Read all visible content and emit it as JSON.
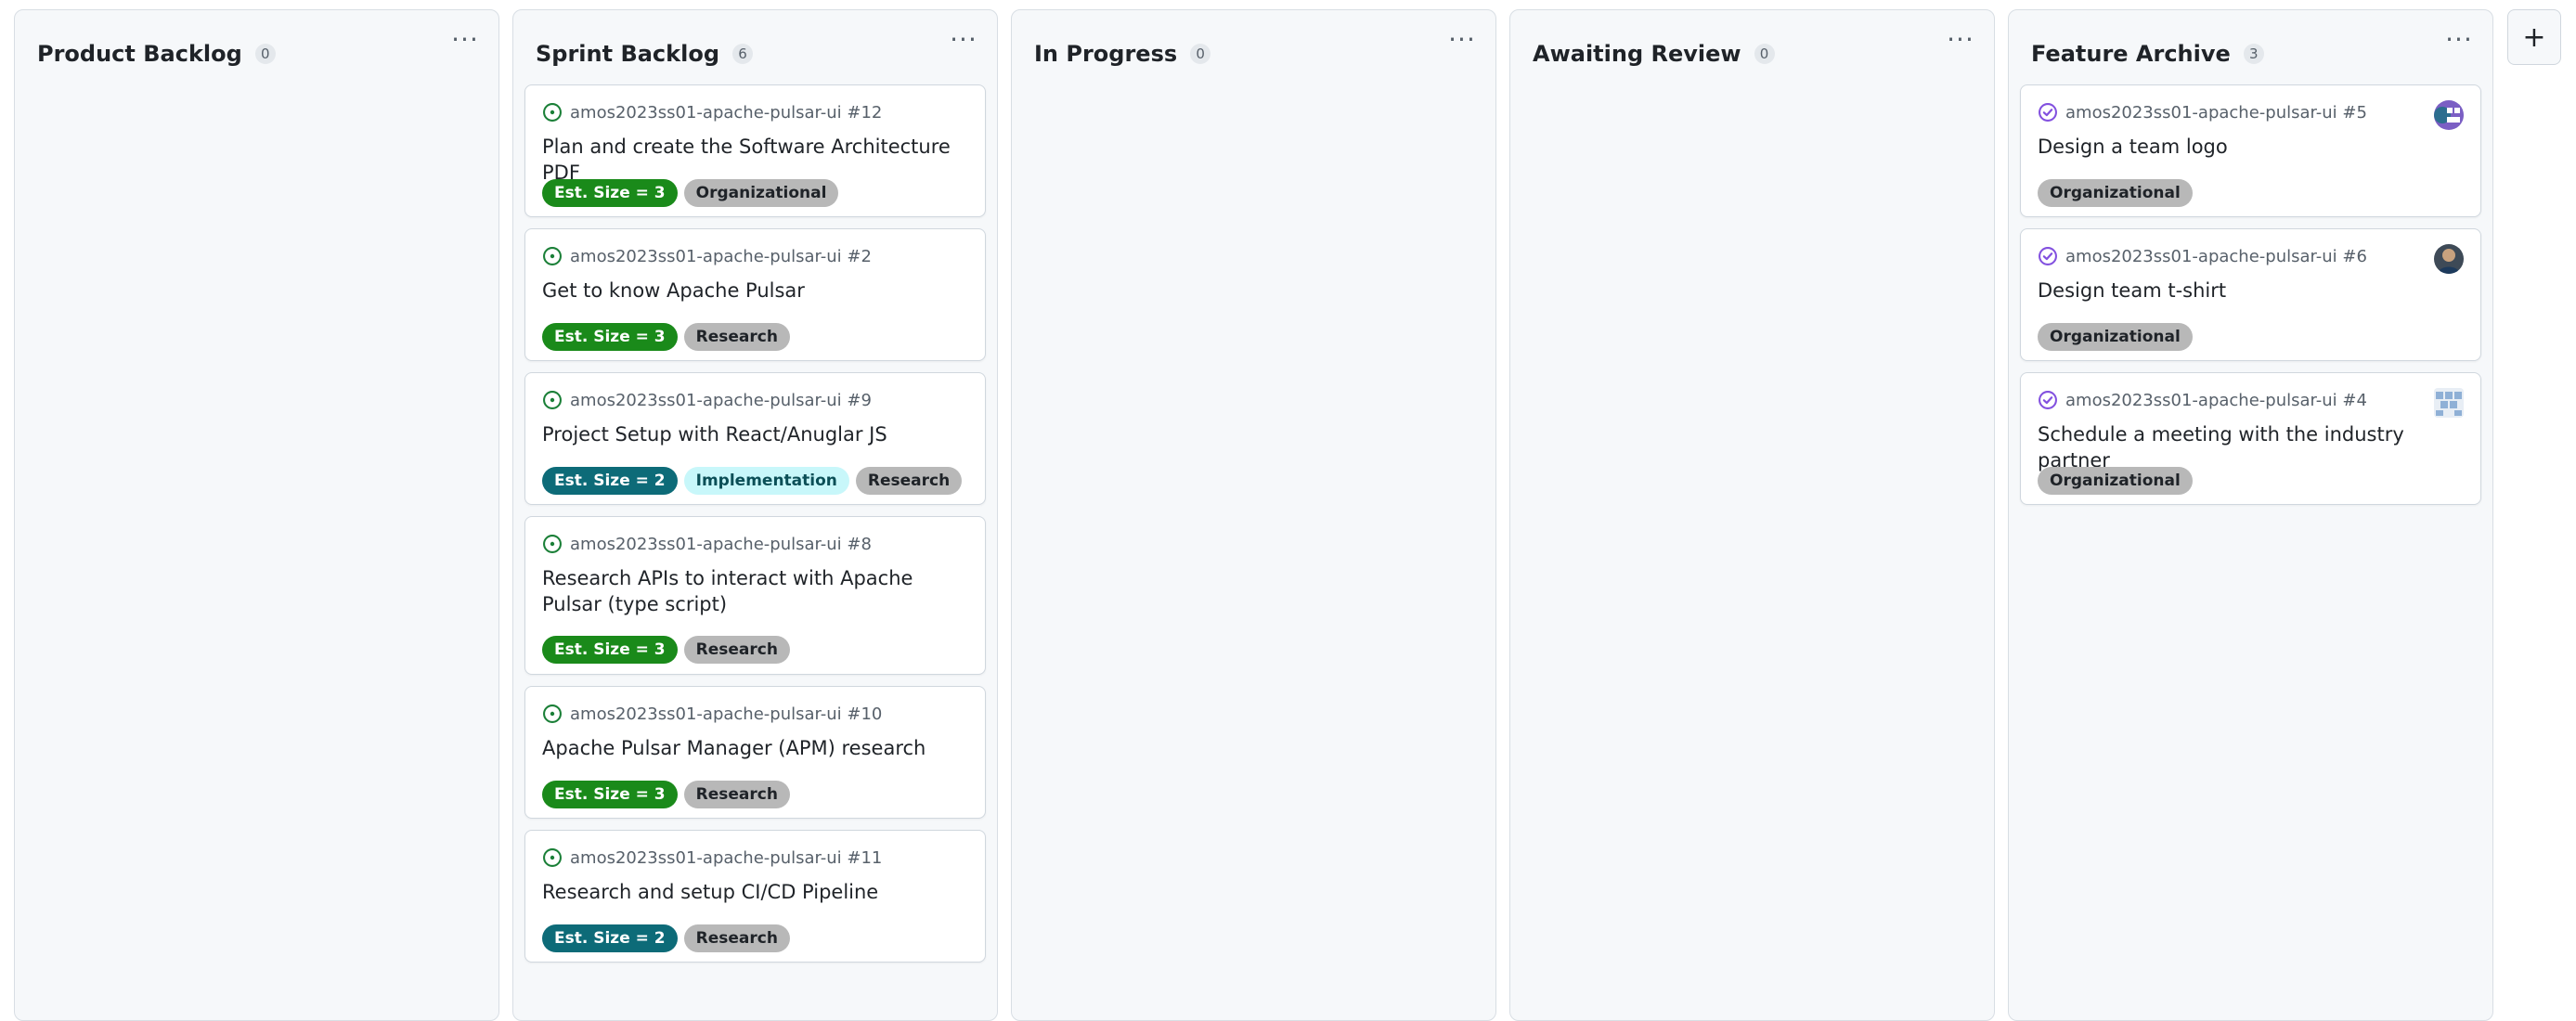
{
  "colors": {
    "open_issue_green": "#1a7f37",
    "closed_issue_purple": "#8250df",
    "size3_bg": "#1a8a1a",
    "size2_bg": "#0d6b78",
    "organizational_bg": "#b8b8b8",
    "research_bg": "#b8b8b8",
    "implementation_bg": "#c8f7fa"
  },
  "add_column": {
    "label": "+"
  },
  "columns": [
    {
      "title": "Product Backlog",
      "count": "0",
      "menu": "···",
      "cards": []
    },
    {
      "title": "Sprint Backlog",
      "count": "6",
      "menu": "···",
      "cards": [
        {
          "ref": "amos2023ss01-apache-pulsar-ui #12",
          "title": "Plan and create the Software Architecture PDF",
          "status": "open",
          "labels": [
            "Est. Size = 3",
            "Organizational"
          ]
        },
        {
          "ref": "amos2023ss01-apache-pulsar-ui #2",
          "title": "Get to know Apache Pulsar",
          "status": "open",
          "labels": [
            "Est. Size = 3",
            "Research"
          ]
        },
        {
          "ref": "amos2023ss01-apache-pulsar-ui #9",
          "title": "Project Setup with React/Anuglar JS",
          "status": "open",
          "labels": [
            "Est. Size = 2",
            "Implementation",
            "Research"
          ]
        },
        {
          "ref": "amos2023ss01-apache-pulsar-ui #8",
          "title": "Research APIs to interact with Apache Pulsar (type script)",
          "status": "open",
          "labels": [
            "Est. Size = 3",
            "Research"
          ]
        },
        {
          "ref": "amos2023ss01-apache-pulsar-ui #10",
          "title": "Apache Pulsar Manager (APM) research",
          "status": "open",
          "labels": [
            "Est. Size = 3",
            "Research"
          ]
        },
        {
          "ref": "amos2023ss01-apache-pulsar-ui #11",
          "title": "Research and setup CI/CD Pipeline",
          "status": "open",
          "labels": [
            "Est. Size = 2",
            "Research"
          ]
        }
      ]
    },
    {
      "title": "In Progress",
      "count": "0",
      "menu": "···",
      "cards": []
    },
    {
      "title": "Awaiting Review",
      "count": "0",
      "menu": "···",
      "cards": []
    },
    {
      "title": "Feature Archive",
      "count": "3",
      "menu": "···",
      "cards": [
        {
          "ref": "amos2023ss01-apache-pulsar-ui #5",
          "title": "Design a team logo",
          "status": "closed",
          "labels": [
            "Organizational"
          ],
          "avatar": "group-avatar"
        },
        {
          "ref": "amos2023ss01-apache-pulsar-ui #6",
          "title": "Design team t-shirt",
          "status": "closed",
          "labels": [
            "Organizational"
          ],
          "avatar": "user-avatar"
        },
        {
          "ref": "amos2023ss01-apache-pulsar-ui #4",
          "title": "Schedule a meeting with the industry partner",
          "status": "closed",
          "labels": [
            "Organizational"
          ],
          "avatar": "pattern-avatar"
        }
      ]
    }
  ]
}
